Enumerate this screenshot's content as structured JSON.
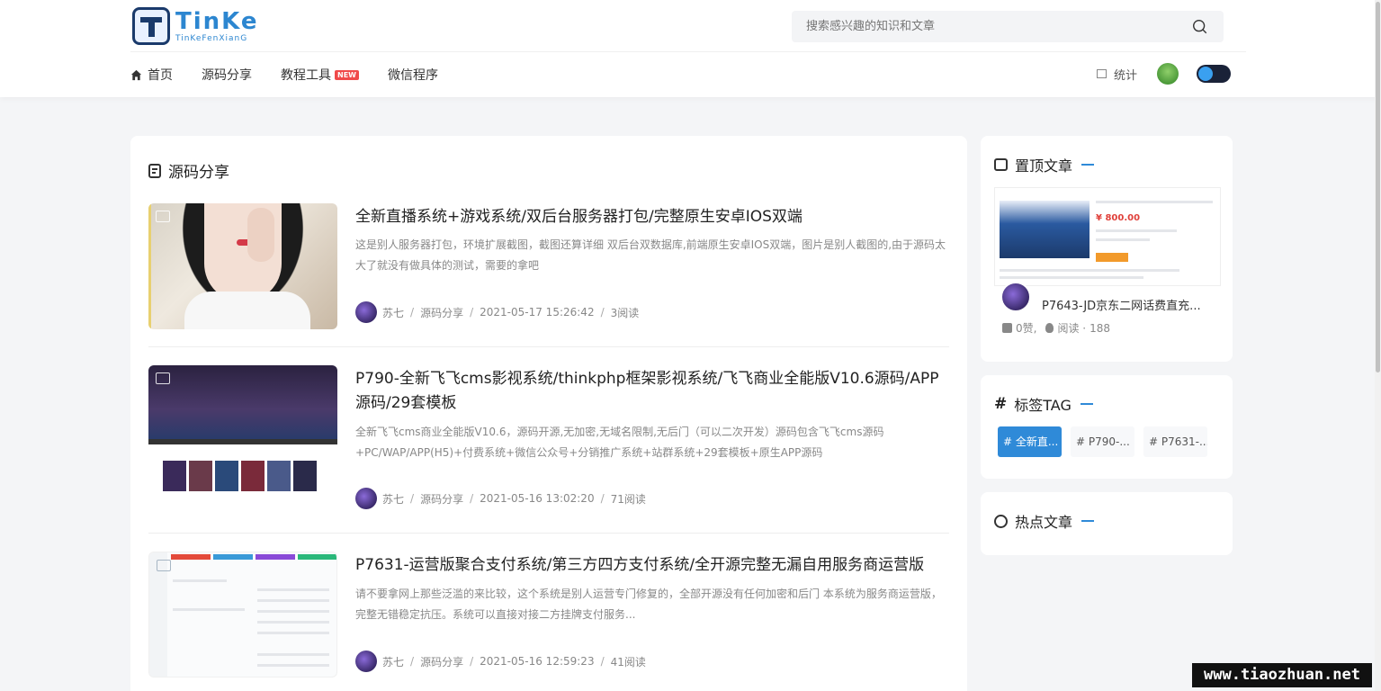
{
  "header": {
    "logo_title": "TinKe",
    "logo_sub": "TinKeFenXianG",
    "search_placeholder": "搜索感兴趣的知识和文章",
    "nav": [
      {
        "label": "首页"
      },
      {
        "label": "源码分享"
      },
      {
        "label": "教程工具",
        "badge": "NEW"
      },
      {
        "label": "微信程序"
      }
    ],
    "stats_label": "统计"
  },
  "main": {
    "section_title": "源码分享",
    "posts": [
      {
        "title": "全新直播系统+游戏系统/双后台服务器打包/完整原生安卓IOS双端",
        "excerpt": "这是别人服务器打包，环境扩展截图，截图还算详细 双后台双数据库,前端原生安卓IOS双端，图片是别人截图的,由于源码太大了就没有做具体的测试，需要的拿吧",
        "author": "苏七",
        "category": "源码分享",
        "date": "2021-05-17 15:26:42",
        "views": "3阅读"
      },
      {
        "title": "P790-全新飞飞cms影视系统/thinkphp框架影视系统/飞飞商业全能版V10.6源码/APP源码/29套模板",
        "excerpt": "全新飞飞cms商业全能版V10.6，源码开源,无加密,无域名限制,无后门（可以二次开发）源码包含飞飞cms源码+PC/WAP/APP(H5)+付费系统+微信公众号+分销推广系统+站群系统+29套模板+原生APP源码",
        "author": "苏七",
        "category": "源码分享",
        "date": "2021-05-16 13:02:20",
        "views": "71阅读"
      },
      {
        "title": "P7631-运营版聚合支付系统/第三方四方支付系统/全开源完整无漏自用服务商运营版",
        "excerpt": "请不要拿网上那些泛滥的来比较，这个系统是别人运营专门修复的，全部开源没有任何加密和后门 本系统为服务商运营版，完整无错稳定抗压。系统可以直接对接二方挂牌支付服务...",
        "author": "苏七",
        "category": "源码分享",
        "date": "2021-05-16 12:59:23",
        "views": "41阅读"
      }
    ]
  },
  "sidebar": {
    "top_title": "置顶文章",
    "top_post": {
      "title": "P7643-JD京东二网话费直充...",
      "price": "¥ 800.00",
      "likes": "0赞,",
      "views_label": "阅读 ·",
      "views": "188"
    },
    "tags_title": "标签TAG",
    "tags": [
      "# 全新直...",
      "# P790-...",
      "# P7631-..."
    ],
    "hot_title": "热点文章"
  },
  "watermark": "www.tiaozhuan.net",
  "colors": {
    "accent": "#2f8ad8",
    "badge": "#f04a4a"
  }
}
